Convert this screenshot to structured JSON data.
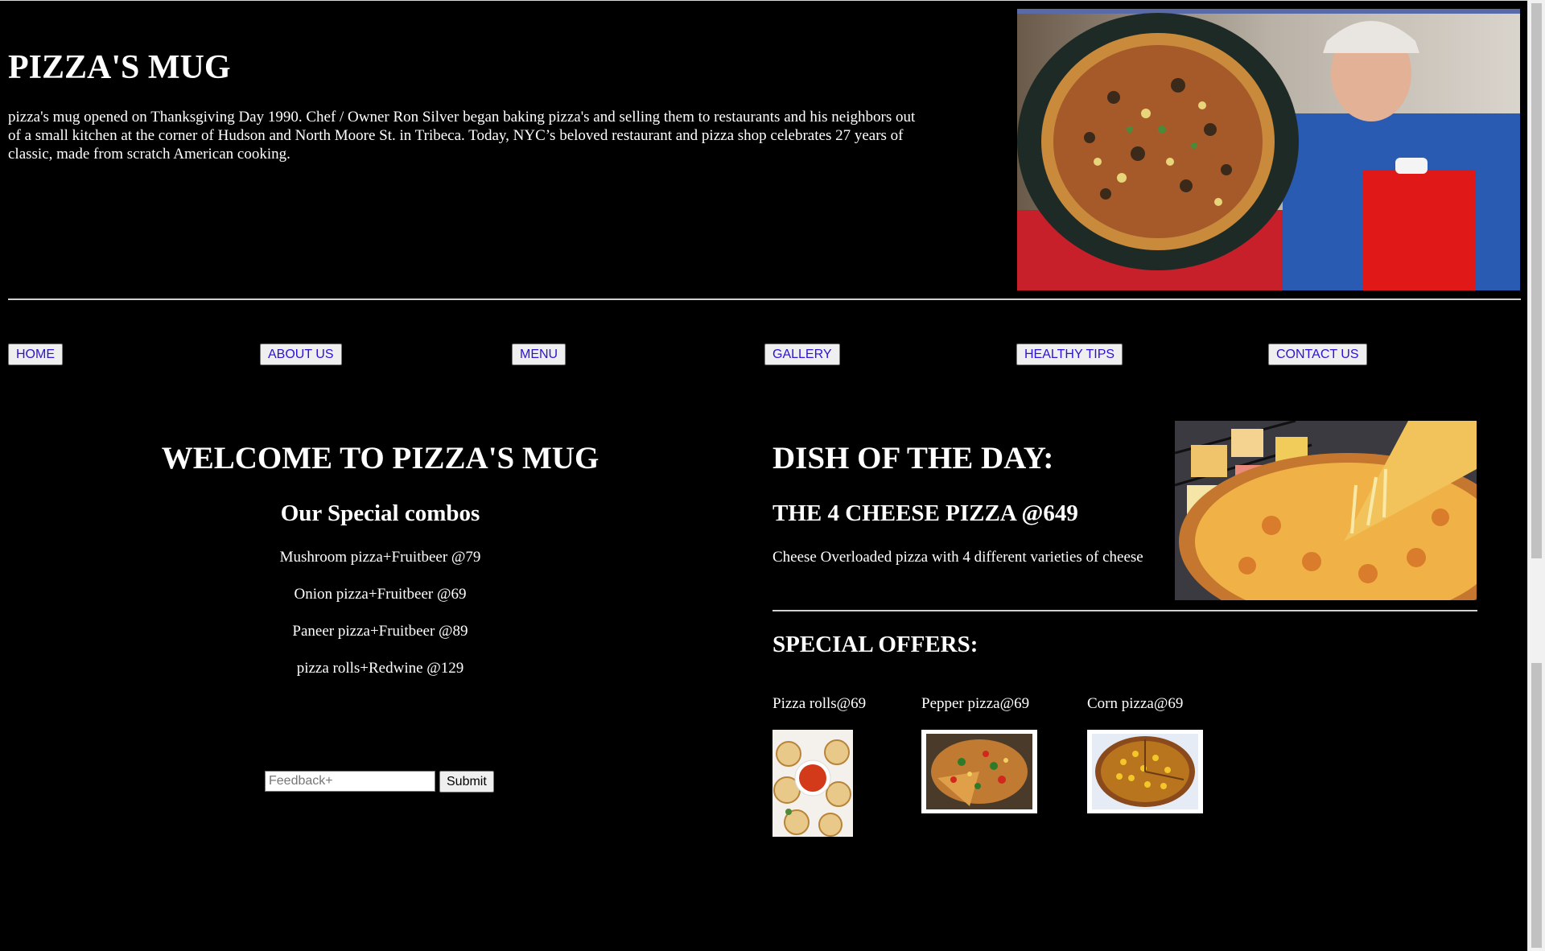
{
  "header": {
    "title": "PIZZA'S MUG",
    "intro": "pizza's mug opened on Thanksgiving Day 1990. Chef / Owner Ron Silver began baking pizza's and selling them to restaurants and his neighbors out of a small kitchen at the corner of Hudson and North Moore St. in Tribeca. Today, NYC’s beloved restaurant and pizza shop celebrates 27 years of classic, made from scratch American cooking."
  },
  "nav": {
    "items": [
      {
        "label": "HOME"
      },
      {
        "label": "ABOUT US"
      },
      {
        "label": "MENU"
      },
      {
        "label": "GALLERY"
      },
      {
        "label": "HEALTHY TIPS"
      },
      {
        "label": "CONTACT US"
      }
    ]
  },
  "welcome": {
    "heading": "WELCOME TO PIZZA'S MUG",
    "combos_heading": "Our Special combos",
    "combos": [
      "Mushroom pizza+Fruitbeer @79",
      "Onion pizza+Fruitbeer @69",
      "Paneer pizza+Fruitbeer @89",
      "pizza rolls+Redwine @129"
    ]
  },
  "feedback": {
    "placeholder": "Feedback+",
    "value": "",
    "submit_label": "Submit"
  },
  "dish": {
    "heading": "DISH OF THE DAY:",
    "name": "THE 4 CHEESE PIZZA @649",
    "description": "Cheese Overloaded pizza with 4 different varieties of cheese"
  },
  "offers": {
    "heading": "SPECIAL OFFERS:",
    "items": [
      {
        "label": "Pizza rolls@69"
      },
      {
        "label": "Pepper pizza@69"
      },
      {
        "label": "Corn pizza@69"
      }
    ]
  },
  "colors": {
    "background": "#000000",
    "text": "#ffffff",
    "link": "#2a12d8",
    "button_bg": "#efefef"
  }
}
